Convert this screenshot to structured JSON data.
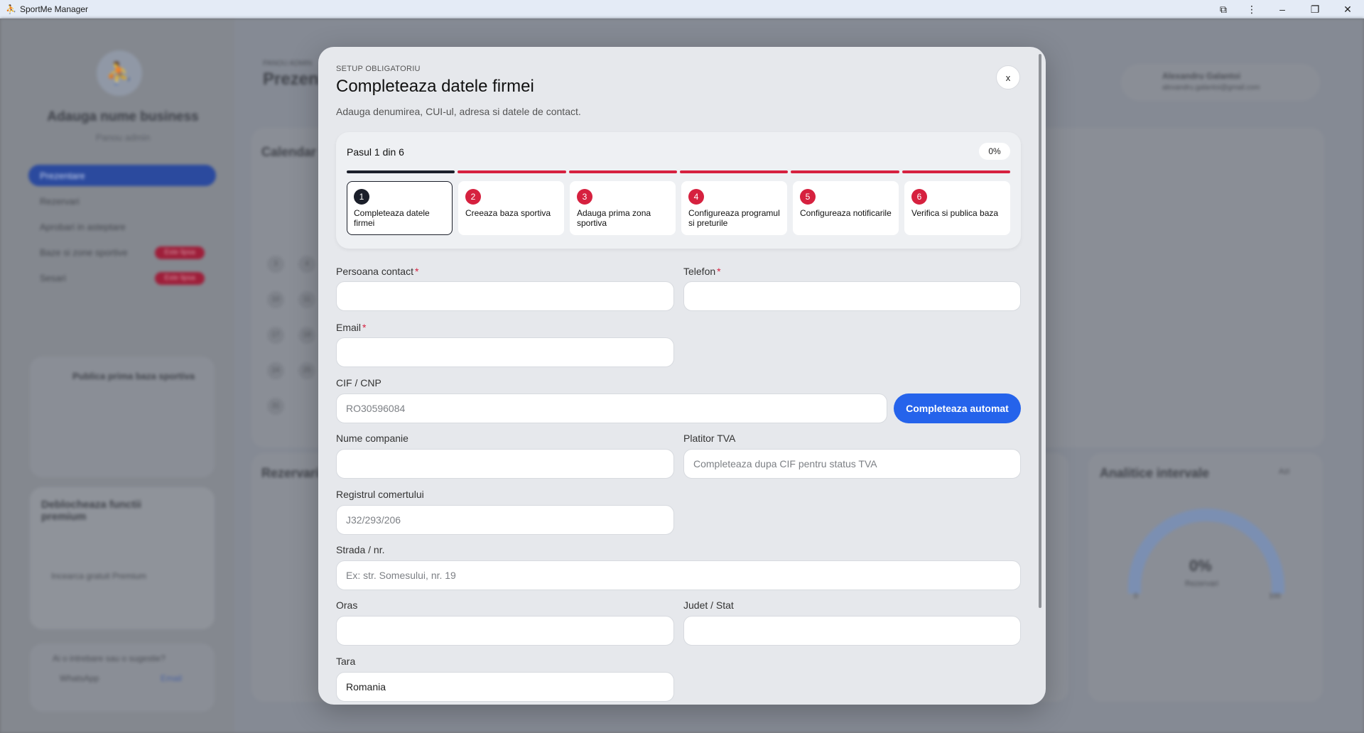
{
  "window": {
    "title": "SportMe Manager"
  },
  "background": {
    "business_name": "Adauga nume business",
    "business_sub": "Panou admin",
    "nav": [
      "Prezentare",
      "Rezervari",
      "Aprobari in asteptare",
      "Baze si zone sportive",
      "Sesari"
    ],
    "nav_badge": "Este lipsa",
    "page_kicker": "PANOU ADMIN",
    "page_title": "Prezen",
    "calendar_title": "Calendar",
    "reservations_title": "Rezervari",
    "analytics_title": "Analitice intervale",
    "analytics_filter": "Azi",
    "gauge_value": "0%",
    "gauge_label": "Rezervari",
    "gauge_min": "0",
    "gauge_max": "100",
    "user_name": "Alexandru Galantoi",
    "user_email": "alexandru.galantoi@gmail.com",
    "promo_title": "Publica prima baza sportiva",
    "premium_title": "Deblocheaza functii premium",
    "premium_button": "Incearca gratuit Premium",
    "help_text": "Ai o intrebare sau o sugestie?",
    "help_whatsapp": "WhatsApp",
    "help_email": "Email",
    "calendar_days": [
      "3",
      "4",
      "10",
      "11",
      "17",
      "18",
      "24",
      "25",
      "31"
    ]
  },
  "modal": {
    "eyebrow": "SETUP OBLIGATORIU",
    "title": "Completeaza datele firmei",
    "subtitle": "Adauga denumirea, CUI-ul, adresa si datele de contact.",
    "close_label": "x",
    "progress": {
      "counter": "Pasul 1 din 6",
      "percent_label": "0%",
      "percent": 0
    },
    "steps": [
      {
        "num": "1",
        "label": "Completeaza datele firmei",
        "active": true
      },
      {
        "num": "2",
        "label": "Creeaza baza sportiva",
        "active": false
      },
      {
        "num": "3",
        "label": "Adauga prima zona sportiva",
        "active": false
      },
      {
        "num": "4",
        "label": "Configureaza programul si preturile",
        "active": false
      },
      {
        "num": "5",
        "label": "Configureaza notificarile",
        "active": false
      },
      {
        "num": "6",
        "label": "Verifica si publica baza",
        "active": false
      }
    ],
    "form": {
      "contact_label": "Persoana contact",
      "contact_value": "",
      "phone_label": "Telefon",
      "phone_value": "",
      "email_label": "Email",
      "email_value": "",
      "cif_label": "CIF / CNP",
      "cif_placeholder": "RO30596084",
      "auto_button": "Completeaza automat",
      "company_label": "Nume companie",
      "company_value": "",
      "vat_label": "Platitor TVA",
      "vat_placeholder": "Completeaza dupa CIF pentru status TVA",
      "registry_label": "Registrul comertului",
      "registry_placeholder": "J32/293/206",
      "street_label": "Strada / nr.",
      "street_placeholder": "Ex: str. Somesului, nr. 19",
      "city_label": "Oras",
      "city_value": "",
      "county_label": "Judet / Stat",
      "county_value": "",
      "country_label": "Tara",
      "country_value": "Romania",
      "required_mark": "*"
    }
  }
}
